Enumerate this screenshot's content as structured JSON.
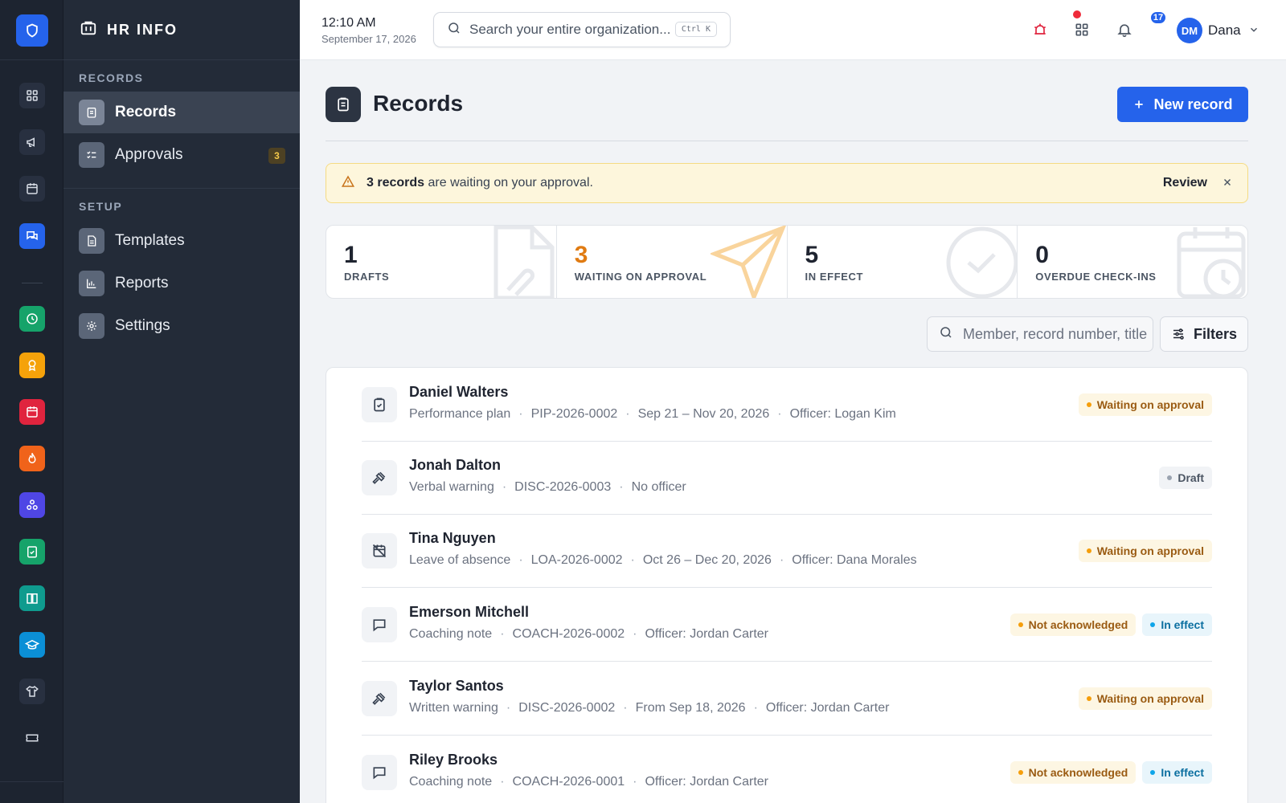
{
  "app": {
    "section_title": "HR INFO"
  },
  "rail": {
    "icons": [
      "dashboard-icon",
      "megaphone-icon",
      "calendar-icon",
      "chat-icon",
      "clock-icon",
      "award-icon",
      "calendar-red-icon",
      "flame-icon",
      "network-icon",
      "clipboard-check-icon",
      "book-icon",
      "graduation-cap-icon",
      "shirt-icon",
      "ticket-icon"
    ]
  },
  "sidebar": {
    "records_section": "RECORDS",
    "setup_section": "SETUP",
    "items": [
      {
        "label": "Records",
        "icon": "clipboard-icon"
      },
      {
        "label": "Approvals",
        "icon": "checklist-icon",
        "badge": "3"
      },
      {
        "label": "Templates",
        "icon": "document-icon"
      },
      {
        "label": "Reports",
        "icon": "bar-chart-icon"
      },
      {
        "label": "Settings",
        "icon": "gear-icon"
      }
    ]
  },
  "topbar": {
    "time": "12:10 AM",
    "date": "September 17, 2026",
    "search_placeholder": "Search your entire organization...",
    "shortcut": "Ctrl K",
    "notifications_count": "17",
    "avatar_initials": "DM",
    "user_name": "Dana"
  },
  "page": {
    "title": "Records",
    "new_button": "New record"
  },
  "alert": {
    "bold": "3 records",
    "text": " are waiting on your approval.",
    "action": "Review"
  },
  "stats": [
    {
      "value": "1",
      "label": "DRAFTS"
    },
    {
      "value": "3",
      "label": "WAITING ON APPROVAL",
      "color": "#e07b12"
    },
    {
      "value": "5",
      "label": "IN EFFECT"
    },
    {
      "value": "0",
      "label": "OVERDUE CHECK-INS"
    }
  ],
  "list": {
    "search_placeholder": "Member, record number, title",
    "filters_label": "Filters",
    "rows": [
      {
        "name": "Daniel Walters",
        "icon": "clipboard-check-icon",
        "meta": [
          "Performance plan",
          "PIP-2026-0002",
          "Sep 21 – Nov 20, 2026",
          "Officer: Logan Kim"
        ],
        "badges": [
          {
            "text": "Waiting on approval",
            "kind": "wait"
          }
        ]
      },
      {
        "name": "Jonah Dalton",
        "icon": "gavel-icon",
        "meta": [
          "Verbal warning",
          "DISC-2026-0003",
          "No officer"
        ],
        "badges": [
          {
            "text": "Draft",
            "kind": "draft"
          }
        ]
      },
      {
        "name": "Tina Nguyen",
        "icon": "calendar-off-icon",
        "meta": [
          "Leave of absence",
          "LOA-2026-0002",
          "Oct 26 – Dec 20, 2026",
          "Officer: Dana Morales"
        ],
        "badges": [
          {
            "text": "Waiting on approval",
            "kind": "wait"
          }
        ]
      },
      {
        "name": "Emerson Mitchell",
        "icon": "message-icon",
        "meta": [
          "Coaching note",
          "COACH-2026-0002",
          "Officer: Jordan Carter"
        ],
        "badges": [
          {
            "text": "Not acknowledged",
            "kind": "wait"
          },
          {
            "text": "In effect",
            "kind": "effect"
          }
        ]
      },
      {
        "name": "Taylor Santos",
        "icon": "gavel-icon",
        "meta": [
          "Written warning",
          "DISC-2026-0002",
          "From Sep 18, 2026",
          "Officer: Jordan Carter"
        ],
        "badges": [
          {
            "text": "Waiting on approval",
            "kind": "wait"
          }
        ]
      },
      {
        "name": "Riley Brooks",
        "icon": "message-icon",
        "meta": [
          "Coaching note",
          "COACH-2026-0001",
          "Officer: Jordan Carter"
        ],
        "badges": [
          {
            "text": "Not acknowledged",
            "kind": "wait"
          },
          {
            "text": "In effect",
            "kind": "effect"
          }
        ]
      }
    ]
  }
}
